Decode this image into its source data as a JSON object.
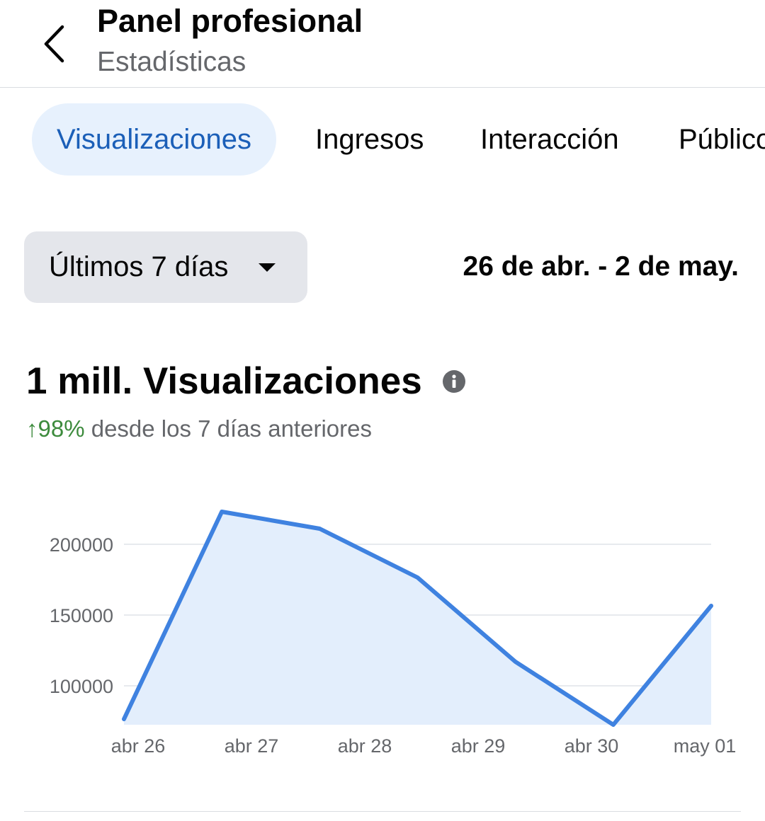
{
  "header": {
    "title": "Panel profesional",
    "subtitle": "Estadísticas",
    "back_icon": "chevron-left-icon"
  },
  "tabs": [
    {
      "label": "Visualizaciones",
      "active": true
    },
    {
      "label": "Ingresos",
      "active": false
    },
    {
      "label": "Interacción",
      "active": false
    },
    {
      "label": "Público",
      "active": false
    }
  ],
  "filter": {
    "period_label": "Últimos 7 días",
    "date_range": "26 de abr. - 2 de may."
  },
  "summary": {
    "headline": "1 mill. Visualizaciones",
    "change_arrow": "↑",
    "change_pct": "98%",
    "change_text": " desde los 7 días anteriores",
    "info_icon": "info-icon"
  },
  "colors": {
    "accent": "#1b5fb8",
    "tab_active_bg": "#e7f1fd",
    "line": "#3f82e0",
    "area": "#e3eefc",
    "positive": "#3d8b3d",
    "muted": "#65676b"
  },
  "chart_data": {
    "type": "area",
    "x_labels": [
      "abr 26",
      "abr 27",
      "abr 28",
      "abr 29",
      "abr 30",
      "may 01"
    ],
    "values": [
      76500,
      223000,
      211000,
      176500,
      117000,
      72500,
      156500
    ],
    "y_ticks": [
      100000,
      150000,
      200000
    ],
    "ylim": [
      72500,
      230000
    ],
    "grid": true,
    "legend": "none"
  }
}
